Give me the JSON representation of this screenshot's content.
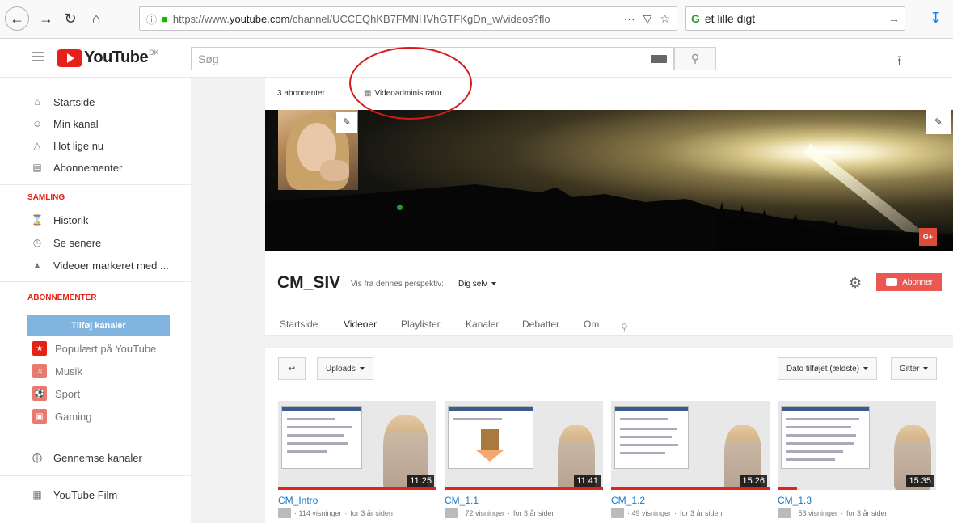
{
  "browser": {
    "url_prefix": "https://www.",
    "url_domain": "youtube.com",
    "url_rest": "/channel/UCCEQhKB7FMNHVhGTFKgDn_w/videos?flo",
    "url_tools": "···",
    "search_value": "et lille digt"
  },
  "masthead": {
    "logo_text": "YouTube",
    "region": "DK",
    "search_placeholder": "Søg"
  },
  "sidebar": {
    "main_items": [
      {
        "label": "Startside",
        "icon": "home-icon"
      },
      {
        "label": "Min kanal",
        "icon": "person-icon"
      },
      {
        "label": "Hot lige nu",
        "icon": "flame-icon"
      },
      {
        "label": "Abonnementer",
        "icon": "subscriptions-icon"
      }
    ],
    "library_heading": "SAMLING",
    "library_items": [
      {
        "label": "Historik",
        "icon": "hourglass-icon"
      },
      {
        "label": "Se senere",
        "icon": "clock-icon"
      },
      {
        "label": "Videoer markeret med ...",
        "icon": "thumbs-up-icon"
      }
    ],
    "subs_heading": "ABONNEMENTER",
    "add_channels_label": "Tilføj kanaler",
    "categories": [
      {
        "label": "Populært på YouTube",
        "color": "#e62117"
      },
      {
        "label": "Musik",
        "color": "#e62117"
      },
      {
        "label": "Sport",
        "color": "#e62117"
      },
      {
        "label": "Gaming",
        "color": "#e62117"
      }
    ],
    "browse_channels": "Gennemse kanaler",
    "youtube_film": "YouTube Film"
  },
  "channel": {
    "subscribers": "3 abonnenter",
    "video_admin": "Videoadministrator",
    "name": "CM_SIV",
    "perspective_label": "Vis fra dennes perspektiv:",
    "perspective_value": "Dig selv",
    "subscribe_label": "Abonner",
    "gplus_label": "G+",
    "tabs": [
      "Startside",
      "Videoer",
      "Playlister",
      "Kanaler",
      "Debatter",
      "Om"
    ],
    "active_tab": "Videoer"
  },
  "toolbar": {
    "uploads_label": "Uploads",
    "sort_label": "Dato tilføjet (ældste)",
    "view_label": "Gitter"
  },
  "videos": [
    {
      "title": "CM_Intro",
      "duration": "11:25",
      "views": "114 visninger",
      "age": "for 3 år siden",
      "watched": 1.0
    },
    {
      "title": "CM_1.1",
      "duration": "11:41",
      "views": "72 visninger",
      "age": "for 3 år siden",
      "watched": 1.0
    },
    {
      "title": "CM_1.2",
      "duration": "15:26",
      "views": "49 visninger",
      "age": "for 3 år siden",
      "watched": 1.0
    },
    {
      "title": "CM_1.3",
      "duration": "15:35",
      "views": "53 visninger",
      "age": "for 3 år siden",
      "watched": 0.12
    }
  ],
  "colors": {
    "accent_red": "#e62117",
    "link_blue": "#167ac6",
    "annotation_red": "#d61a1a"
  }
}
